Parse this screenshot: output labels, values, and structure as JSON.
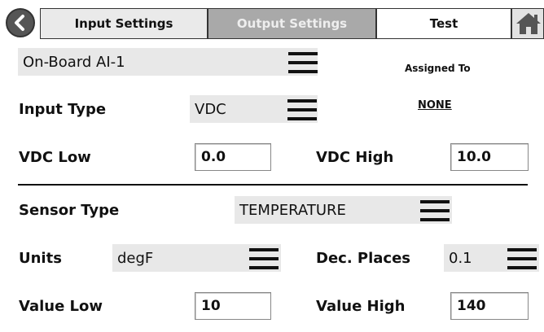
{
  "tabs": {
    "input_settings": "Input Settings",
    "output_settings": "Output Settings",
    "test": "Test"
  },
  "channel": {
    "selected": "On-Board AI-1",
    "assigned_to_label": "Assigned To",
    "assigned_to_value": "NONE"
  },
  "input_type": {
    "label": "Input Type",
    "value": "VDC"
  },
  "vdc": {
    "low_label": "VDC Low",
    "low_value": "0.0",
    "high_label": "VDC High",
    "high_value": "10.0"
  },
  "sensor_type": {
    "label": "Sensor Type",
    "value": "TEMPERATURE"
  },
  "units": {
    "label": "Units",
    "value": "degF"
  },
  "dec_places": {
    "label": "Dec. Places",
    "value": "0.1"
  },
  "value_range": {
    "low_label": "Value Low",
    "low_value": "10",
    "high_label": "Value High",
    "high_value": "140"
  },
  "icons": {
    "back": "chevron-left-icon",
    "home": "home-icon",
    "menu": "hamburger-menu-icon"
  },
  "colors": {
    "active_tab": "#eaeaea",
    "inactive_tab": "#a9a9a9",
    "select_bg": "#e8e8e8"
  }
}
